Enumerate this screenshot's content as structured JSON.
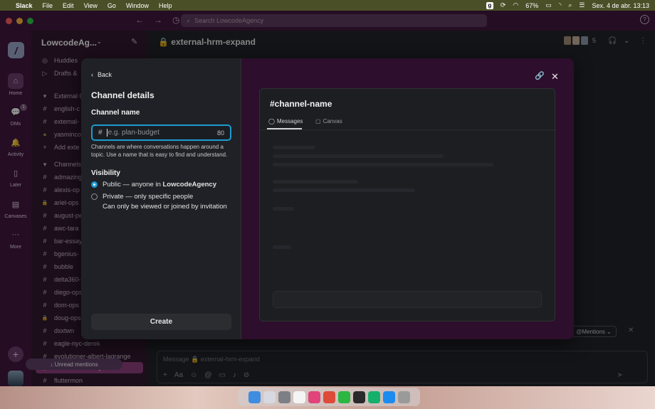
{
  "menubar": {
    "app": "Slack",
    "menus": [
      "File",
      "Edit",
      "View",
      "Go",
      "Window",
      "Help"
    ],
    "battery": "67%",
    "datetime": "Sex. 4 de abr.  13:13"
  },
  "titlebar": {
    "search_placeholder": "Search LowcodeAgency"
  },
  "rail": {
    "items": [
      {
        "label": "Home"
      },
      {
        "label": "DMs",
        "badge": "1"
      },
      {
        "label": "Activity"
      },
      {
        "label": "Later"
      },
      {
        "label": "Canvases"
      },
      {
        "label": "More"
      }
    ]
  },
  "sidebar": {
    "workspace": "LowcodeAg...",
    "items": [
      {
        "prefix": "◎",
        "label": "Huddles"
      },
      {
        "prefix": "▷",
        "label": "Drafts &"
      },
      {
        "prefix": "▾",
        "label": "External C"
      },
      {
        "prefix": "#",
        "label": "english-c"
      },
      {
        "prefix": "#",
        "label": "external-"
      },
      {
        "prefix": "●",
        "label": "yasminco"
      },
      {
        "prefix": "+",
        "label": "Add exte"
      },
      {
        "prefix": "▾",
        "label": "Channels"
      },
      {
        "prefix": "#",
        "label": "admazing"
      },
      {
        "prefix": "#",
        "label": "alexis-op"
      },
      {
        "prefix": "🔒",
        "label": "ariel-ops"
      },
      {
        "prefix": "#",
        "label": "august-pe"
      },
      {
        "prefix": "#",
        "label": "awc-tara"
      },
      {
        "prefix": "#",
        "label": "bar-essay"
      },
      {
        "prefix": "#",
        "label": "bgenius-"
      },
      {
        "prefix": "#",
        "label": "bubble"
      },
      {
        "prefix": "#",
        "label": "delta360-"
      },
      {
        "prefix": "#",
        "label": "diego-ops"
      },
      {
        "prefix": "#",
        "label": "dom-ops"
      },
      {
        "prefix": "🔒",
        "label": "doug-ops"
      },
      {
        "prefix": "#",
        "label": "dsxtwn"
      },
      {
        "prefix": "#",
        "label": "eagle-nyc-derek"
      },
      {
        "prefix": "#",
        "label": "evolutioner-albert-lagrange"
      },
      {
        "prefix": "🔒",
        "label": "external-hrm-expand"
      },
      {
        "prefix": "#",
        "label": "fluttermon"
      }
    ],
    "unread_label": "↓ Unread mentions"
  },
  "channel": {
    "name": "external-hrm-expand",
    "member_count": "5",
    "mentions_label": "@Mentions ⌄",
    "composer_placeholder": "Message 🔒 external-hrm-expand"
  },
  "modal": {
    "back_label": "Back",
    "title": "Channel details",
    "name_label": "Channel name",
    "name_prefix": "#",
    "name_placeholder": "e.g. plan-budget",
    "name_value": "",
    "char_count": "80",
    "name_help": "Channels are where conversations happen around a topic. Use a name that is easy to find and understand.",
    "visibility_label": "Visibility",
    "public_text": "Public — anyone in ",
    "public_org": "LowcodeAgency",
    "private_text": "Private — only specific people",
    "private_sub": "Can only be viewed or joined by invitation",
    "create_label": "Create",
    "preview": {
      "title": "#channel-name",
      "tab_messages": "Messages",
      "tab_canvas": "Canvas"
    }
  },
  "colors": {
    "aubergine": "#3b0f3a",
    "focus_blue": "#1d9bd1",
    "selected_channel": "#8b3a7a"
  }
}
